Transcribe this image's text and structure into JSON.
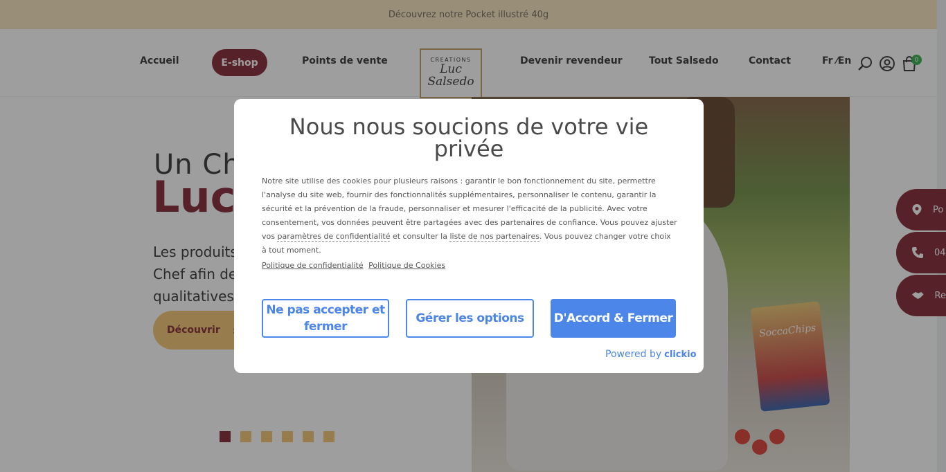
{
  "promo": {
    "text": "Découvrez notre Pocket illustré 40g"
  },
  "nav": {
    "items": [
      "Accueil",
      "E-shop",
      "Points de vente",
      "Devenir revendeur",
      "Tout Salsedo",
      "Contact"
    ],
    "lang": "Fr ⁄En",
    "cart_count": "0"
  },
  "logo": {
    "line1": "CREATIONS",
    "line2": "Luc",
    "line3": "Salsedo"
  },
  "hero": {
    "title1": "Un Ch",
    "title2": "Luc",
    "lines": [
      "Les produits",
      "Chef afin de c",
      "qualitatives e"
    ],
    "discover_label": "Découvrir",
    "bag_text": "SoccaChips"
  },
  "side": {
    "points": "Po",
    "phone": "04",
    "resale": "Re"
  },
  "modal": {
    "title": "Nous nous soucions de votre vie privée",
    "body_1": "Notre site utilise des cookies pour plusieurs raisons : garantir le bon fonctionnement du site, permettre l'analyse du site web, fournir des fonctionnalités supplémentaires, personnaliser le contenu, garantir la sécurité et la prévention de la fraude, personnaliser et mesurer l'efficacité de la publicité. Avec votre consentement, vos données peuvent être partagées avec des partenaires de confiance. Vous pouvez ajuster vos ",
    "link_privacy_settings": "paramètres de confidentialité",
    "body_2": " et consulter la ",
    "link_partners": "liste de nos partenaires",
    "body_3": ". Vous pouvez changer votre choix à tout moment.",
    "policy_privacy": "Politique de confidentialité",
    "policy_cookies": "Politique de Cookies",
    "btn_reject": "Ne pas accepter et fermer",
    "btn_manage": "Gérer les options",
    "btn_accept": "D'Accord & Fermer",
    "powered_by": "Powered by",
    "brand": "clickio"
  },
  "colors": {
    "brand": "#7e1c2a",
    "gold": "#f2c46e",
    "cmp_blue": "#4c86e8"
  }
}
